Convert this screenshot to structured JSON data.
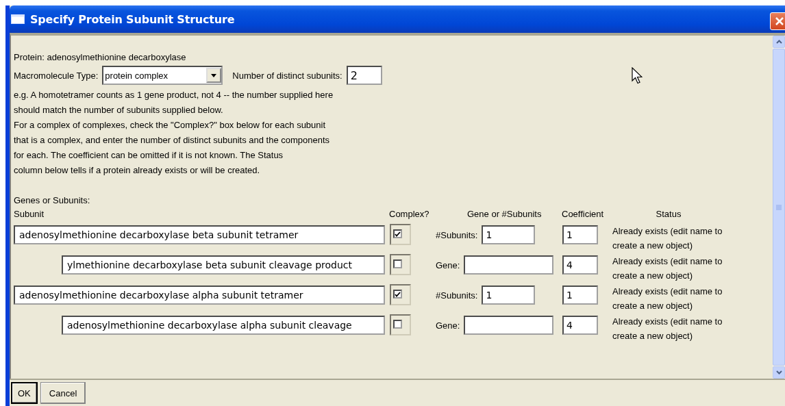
{
  "window": {
    "title": "Specify Protein Subunit Structure"
  },
  "protein_label": "Protein: adenosylmethionine decarboxylase",
  "macromolecule_type": {
    "label": "Macromolecule Type:",
    "value": "protein complex"
  },
  "distinct_subunits": {
    "label": "Number of distinct subunits:",
    "value": "2"
  },
  "notes": [
    "e.g. A homotetramer counts as 1 gene product, not 4 -- the number supplied here",
    "should match the number of subunits supplied below.",
    "For a complex of complexes, check the \"Complex?\" box below for each subunit",
    "that is a complex, and enter the number of distinct subunits and the components",
    "for each.  The coefficient can be omitted if it is not known.  The Status",
    "column below tells if a protein already exists or will be created."
  ],
  "section_label": "Genes or Subunits:",
  "columns": [
    "Subunit",
    "Complex?",
    "Gene or #Subunits",
    "Coefficient",
    "Status"
  ],
  "subunits": [
    {
      "name": "adenosylmethionine decarboxylase beta subunit tetramer",
      "complex": true,
      "component_label": "#Subunits:",
      "component_value": "1",
      "coefficient": "1",
      "status": "Already exists (edit name to create a new object)",
      "children": [
        {
          "name": "ylmethionine decarboxylase beta subunit cleavage product",
          "complex": false,
          "component_label": "Gene:",
          "coefficient": "4",
          "status": "Already exists (edit name to create a new object)"
        }
      ]
    },
    {
      "name": "adenosylmethionine decarboxylase alpha subunit tetramer",
      "complex": true,
      "component_label": "#Subunits:",
      "component_value": "1",
      "coefficient": "1",
      "status": "Already exists (edit name to create a new object)",
      "children": [
        {
          "name": "adenosylmethionine decarboxylase alpha subunit cleavage",
          "complex": false,
          "component_label": "Gene:",
          "coefficient": "4",
          "status": "Already exists (edit name to create a new object)"
        }
      ]
    }
  ],
  "buttons": [
    {
      "label": "OK",
      "default": true
    },
    {
      "label": "Cancel",
      "default": false
    }
  ]
}
